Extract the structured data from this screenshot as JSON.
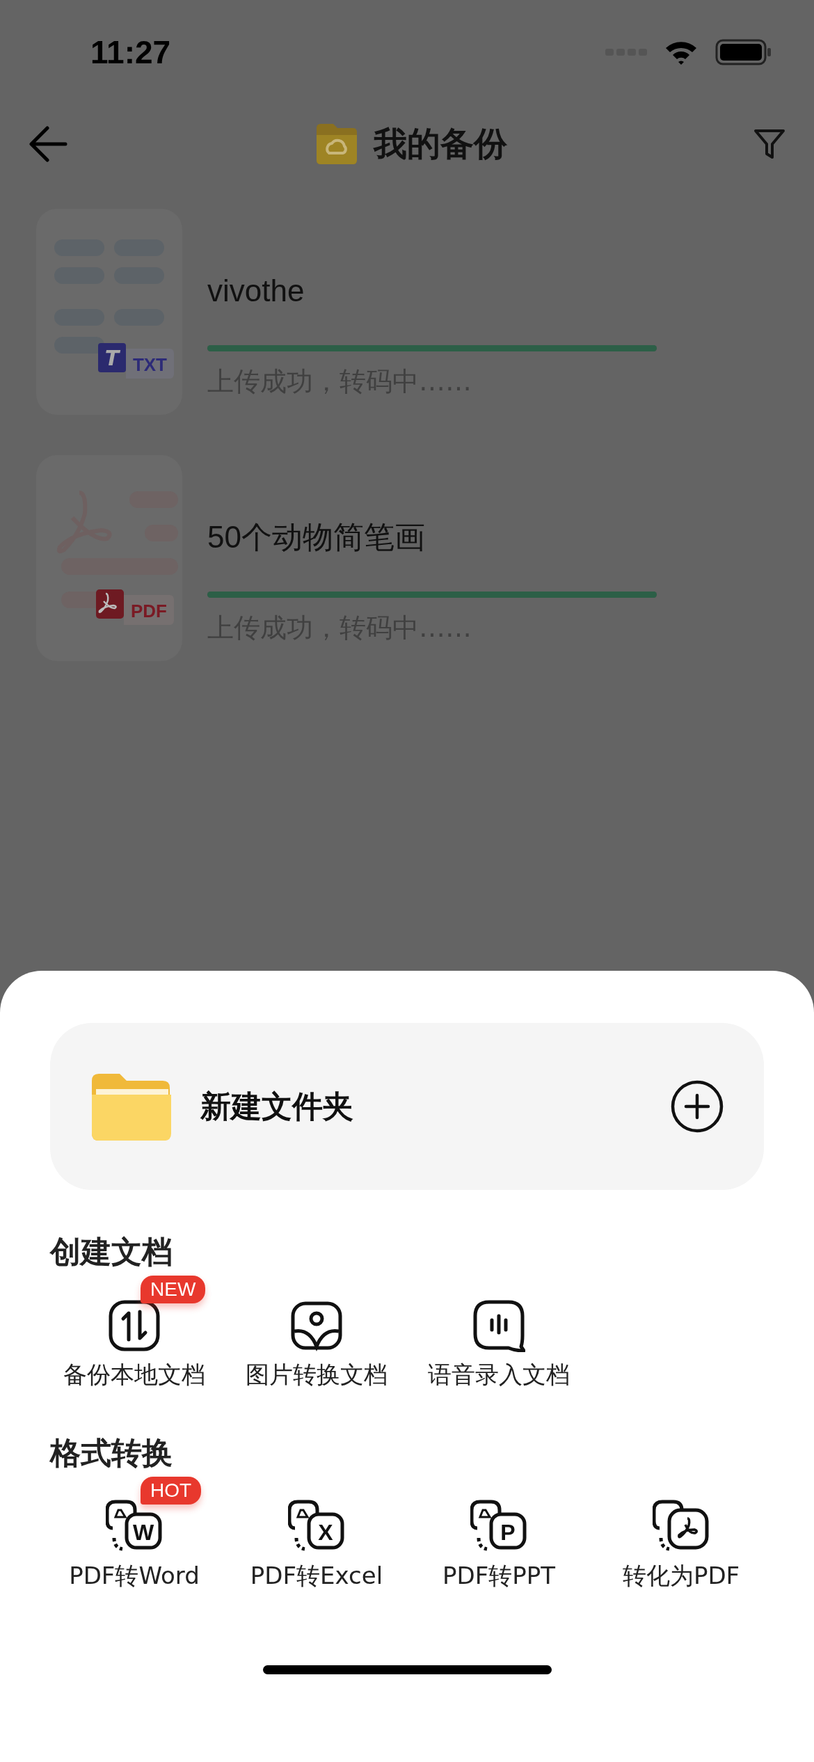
{
  "status_bar": {
    "time": "11:27"
  },
  "header": {
    "title": "我的备份"
  },
  "files": [
    {
      "name": "vivothe",
      "kind": "txt",
      "badge": "TXT",
      "badge_mark": "T",
      "level": 1,
      "status": "上传成功，转码中……"
    },
    {
      "name": "50个动物简笔画",
      "kind": "pdf",
      "badge": "PDF",
      "level": 1,
      "status": "上传成功，转码中……"
    }
  ],
  "sheet": {
    "new_folder": {
      "label": "新建文件夹"
    },
    "sections": [
      {
        "title": "创建文档",
        "items": [
          {
            "label": "备份本地文档",
            "kind": "updown",
            "tag": "NEW"
          },
          {
            "label": "图片转换文档",
            "kind": "image"
          },
          {
            "label": "语音录入文档",
            "kind": "voice"
          }
        ]
      },
      {
        "title": "格式转换",
        "items": [
          {
            "label": "PDF转Word",
            "kind": "convert",
            "glyph": "W",
            "tag": "HOT"
          },
          {
            "label": "PDF转Excel",
            "kind": "convert",
            "glyph": "X"
          },
          {
            "label": "PDF转PPT",
            "kind": "convert",
            "glyph": "P"
          },
          {
            "label": "转化为PDF",
            "kind": "topdf"
          }
        ]
      }
    ]
  }
}
